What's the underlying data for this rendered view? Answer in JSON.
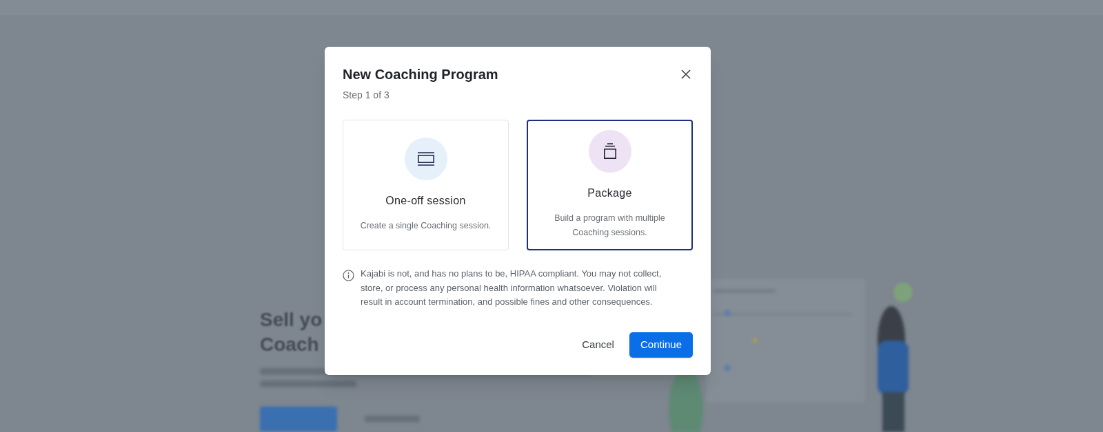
{
  "background": {
    "headline": [
      "Sell yo",
      "Coach"
    ]
  },
  "dialog": {
    "title": "New Coaching Program",
    "step": "Step 1 of 3",
    "options": [
      {
        "kind": "single",
        "title": "One-off session",
        "description": "Create a single Coaching session.",
        "selected": false
      },
      {
        "kind": "package",
        "title": "Package",
        "description": "Build a program with multiple Coaching sessions.",
        "selected": true
      }
    ],
    "notice": "Kajabi is not, and has no plans to be, HIPAA compliant. You may not collect, store, or process any personal health information whatsoever. Violation will result in account termination, and possible fines and other consequences.",
    "buttons": [
      {
        "kind": "secondary",
        "label": "Cancel"
      },
      {
        "kind": "primary",
        "label": "Continue"
      }
    ]
  }
}
